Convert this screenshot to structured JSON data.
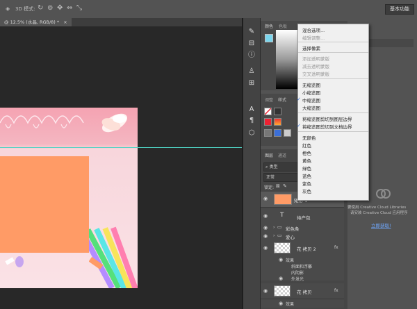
{
  "optbar": {
    "mode_label": "3D 模式:",
    "workspace": "基本功能"
  },
  "doc": {
    "tab": "@ 12.5% (水晶, RGB/8) *"
  },
  "tools": [
    "brush-settings-icon",
    "adjust-icon",
    "info-icon",
    "clone-icon",
    "properties-icon",
    "character-icon",
    "paragraph-icon",
    "3d-icon"
  ],
  "panels": {
    "color_tab": "颜色",
    "swatches_tab": "色板",
    "adj_tab": "调整",
    "styles_tab": "样式",
    "layers_tab": "图层",
    "channels_tab": "通道",
    "kind": "类型",
    "blend": "正常",
    "lock": "锁定:"
  },
  "layers": [
    {
      "name": "矩形 1",
      "type": "shape"
    },
    {
      "name": "待产包",
      "type": "text"
    },
    {
      "name": "彩色条",
      "type": "group"
    },
    {
      "name": "爱心",
      "type": "group"
    },
    {
      "name": "花 拷贝 2",
      "type": "pixel",
      "fx": "fx"
    },
    {
      "name": "效果",
      "type": "effect"
    },
    {
      "name": "斜面和浮雕",
      "type": "effect"
    },
    {
      "name": "内阴影",
      "type": "effect"
    },
    {
      "name": "外发光",
      "type": "effect"
    },
    {
      "name": "花 拷贝",
      "type": "pixel",
      "fx": "fx"
    },
    {
      "name": "效果",
      "type": "effect"
    }
  ],
  "menu": {
    "items": [
      {
        "label": "混合选项...",
        "disabled": false
      },
      {
        "label": "编辑调整...",
        "disabled": true
      },
      {
        "label": "选择像素",
        "disabled": false
      },
      {
        "label": "添加透明蒙版",
        "disabled": true
      },
      {
        "label": "减去透明蒙版",
        "disabled": true
      },
      {
        "label": "交叉透明蒙版",
        "disabled": true
      },
      {
        "label": "无缩览图",
        "disabled": false
      },
      {
        "label": "小缩览图",
        "disabled": false
      },
      {
        "label": "中缩览图",
        "disabled": false,
        "checked": true
      },
      {
        "label": "大缩览图",
        "disabled": false
      },
      {
        "label": "将缩览图剪切到图层边界",
        "disabled": false
      },
      {
        "label": "将缩览图剪切到文档边界",
        "disabled": false,
        "checked": true
      },
      {
        "label": "无颜色",
        "disabled": false
      },
      {
        "label": "红色",
        "disabled": false
      },
      {
        "label": "橙色",
        "disabled": false
      },
      {
        "label": "黄色",
        "disabled": false
      },
      {
        "label": "绿色",
        "disabled": false
      },
      {
        "label": "蓝色",
        "disabled": false
      },
      {
        "label": "紫色",
        "disabled": false
      },
      {
        "label": "灰色",
        "disabled": false
      }
    ]
  },
  "cc": {
    "line1": "要使用 Creative Cloud Libraries",
    "line2": "请安装 Creative Cloud 应用程序",
    "link": "立即获取!"
  },
  "colors": {
    "accent": "#2a65d1",
    "guide": "#4fd3c4",
    "orange": "#ff9b66",
    "pink": "#f5a3b2"
  }
}
